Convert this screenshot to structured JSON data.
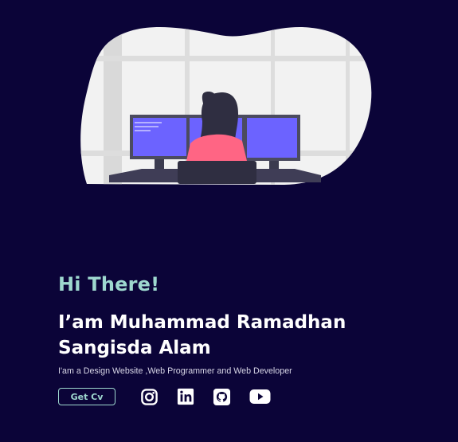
{
  "colors": {
    "background": "#0b0438",
    "accent": "#9ed8cf",
    "heading": "#ffffff",
    "body_text": "#d7d6e6"
  },
  "illustration": {
    "icon": "developer-at-monitors-illustration"
  },
  "hero": {
    "greeting": "Hi There!",
    "name": "I’am Muhammad Ramadhan Sangisda Alam",
    "tagline": "I'am a Design Website ,Web Programmer and Web Developer",
    "cv_button_label": "Get Cv"
  },
  "social_icons": [
    {
      "name": "instagram-icon"
    },
    {
      "name": "linkedin-icon"
    },
    {
      "name": "github-icon"
    },
    {
      "name": "youtube-icon"
    }
  ]
}
